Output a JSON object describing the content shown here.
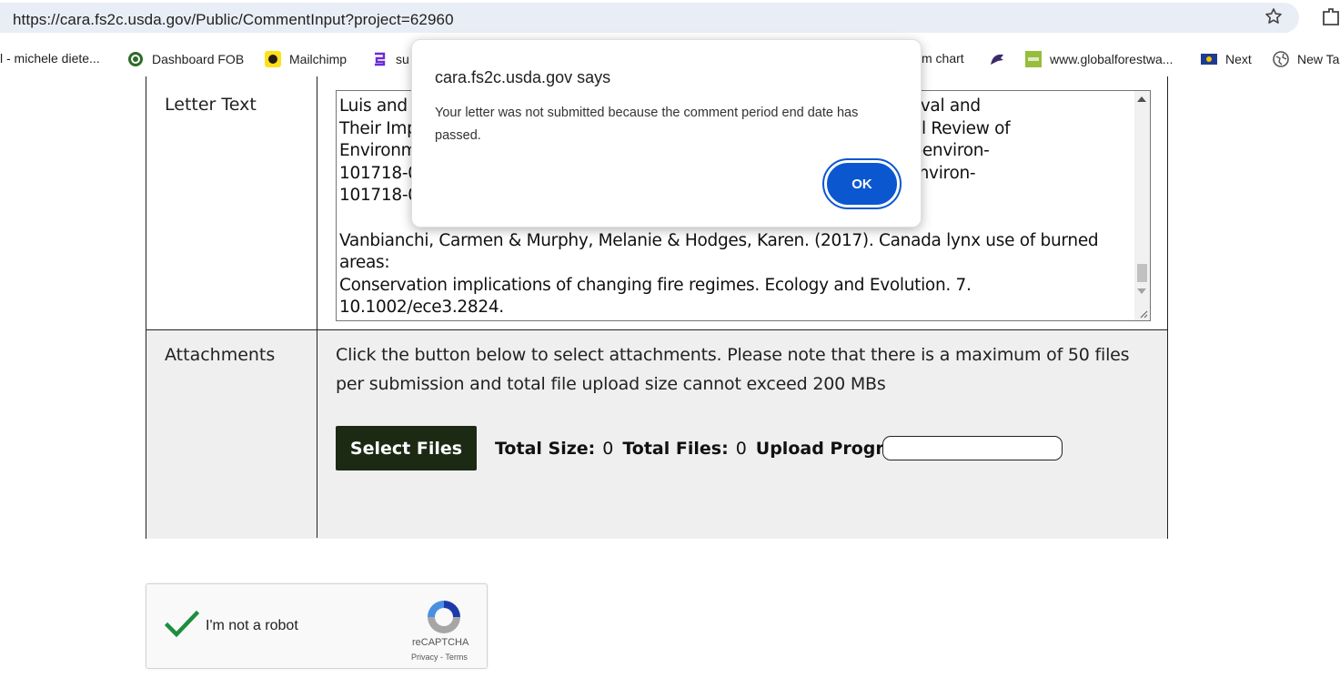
{
  "browser": {
    "url": "https://cara.fs2c.usda.gov/Public/CommentInput?project=62960",
    "bookmarks": [
      {
        "label": "l - michele diete...",
        "icon": "none"
      },
      {
        "label": "Dashboard FOB",
        "icon": "dashboard-icon"
      },
      {
        "label": "Mailchimp",
        "icon": "mailchimp-icon"
      },
      {
        "label": "su",
        "icon": "bookmark-s-icon"
      },
      {
        "label": "m chart",
        "icon": "none"
      },
      {
        "label": "",
        "icon": "cat-icon"
      },
      {
        "label": "www.globalforestwa...",
        "icon": "globalforest-icon"
      },
      {
        "label": "Next",
        "icon": "flag-icon"
      },
      {
        "label": "New Ta",
        "icon": "globe-icon"
      }
    ]
  },
  "form": {
    "letter_label": "Letter Text",
    "letter_text": "Luis and                                                                                se Gas Removal and\nTheir Imp                                                                              Goals, Annual Review of\nEnvironm                                                                              146/annurev-environ-\n101718-0                                                                              -6/annurev-environ-\n101718-0\n\nVanbianchi, Carmen & Murphy, Melanie & Hodges, Karen. (2017). Canada lynx use of burned areas:\nConservation implications of changing fire regimes. Ecology and Evolution. 7. 10.1002/ece3.2824.",
    "attachments_label": "Attachments",
    "attachments_info": "Click the button below to select attachments. Please note that there is a maximum of 50 files per submission and total file upload size cannot exceed 200 MBs",
    "select_files_label": "Select Files",
    "total_size_label": "Total Size:",
    "total_size_value": "0",
    "total_files_label": "Total Files:",
    "total_files_value": "0",
    "upload_progress_label": "Upload Progress:",
    "upload_progress_fraction": 0
  },
  "recaptcha": {
    "label": "I'm not a robot",
    "brand": "reCAPTCHA",
    "links": "Privacy - Terms",
    "checked": true
  },
  "dialog": {
    "title": "cara.fs2c.usda.gov says",
    "message": "Your letter was not submitted because the comment period end date has passed.",
    "ok_label": "OK"
  },
  "colors": {
    "accent": "#0b57d0",
    "button_dark": "#1c2a14",
    "check_green": "#1e8e3e"
  }
}
